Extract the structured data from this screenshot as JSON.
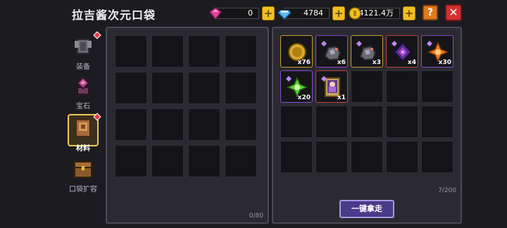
{
  "header": {
    "title": "拉吉酱次元口袋"
  },
  "currencies": [
    {
      "icon": "pink-gem-icon",
      "value": "0"
    },
    {
      "icon": "diamond-icon",
      "value": "4784"
    },
    {
      "icon": "gold-coin-icon",
      "value": "4121.4万"
    }
  ],
  "buttons": {
    "help": "?",
    "close": "✕",
    "plus": "+",
    "take_all": "一键拿走"
  },
  "sidebar": {
    "items": [
      {
        "label": "装备",
        "icon": "armor-icon",
        "badge": true
      },
      {
        "label": "宝石",
        "icon": "gem-stand-icon",
        "badge": false
      },
      {
        "label": "材料",
        "icon": "material-book-icon",
        "badge": true,
        "active": true
      },
      {
        "label": "口袋扩容",
        "icon": "chest-icon",
        "badge": false
      }
    ]
  },
  "left_panel": {
    "capacity": "0/80"
  },
  "right_panel": {
    "capacity": "7/200",
    "items": [
      {
        "name": "coin-token-icon",
        "qty": "x76",
        "rarity": "gold"
      },
      {
        "name": "ore-icon",
        "qty": "x6",
        "rarity": "purple"
      },
      {
        "name": "ore-icon",
        "qty": "x3",
        "rarity": "gold"
      },
      {
        "name": "dark-crystal-icon",
        "qty": "x4",
        "rarity": "red"
      },
      {
        "name": "orange-spark-icon",
        "qty": "x30",
        "rarity": "purple"
      },
      {
        "name": "green-spark-icon",
        "qty": "x20",
        "rarity": "purple"
      },
      {
        "name": "character-card-icon",
        "qty": "x1",
        "rarity": "red"
      }
    ]
  },
  "colors": {
    "gold": "#f0c020",
    "accent_purple": "#8a4ad0",
    "close_red": "#d23030"
  }
}
